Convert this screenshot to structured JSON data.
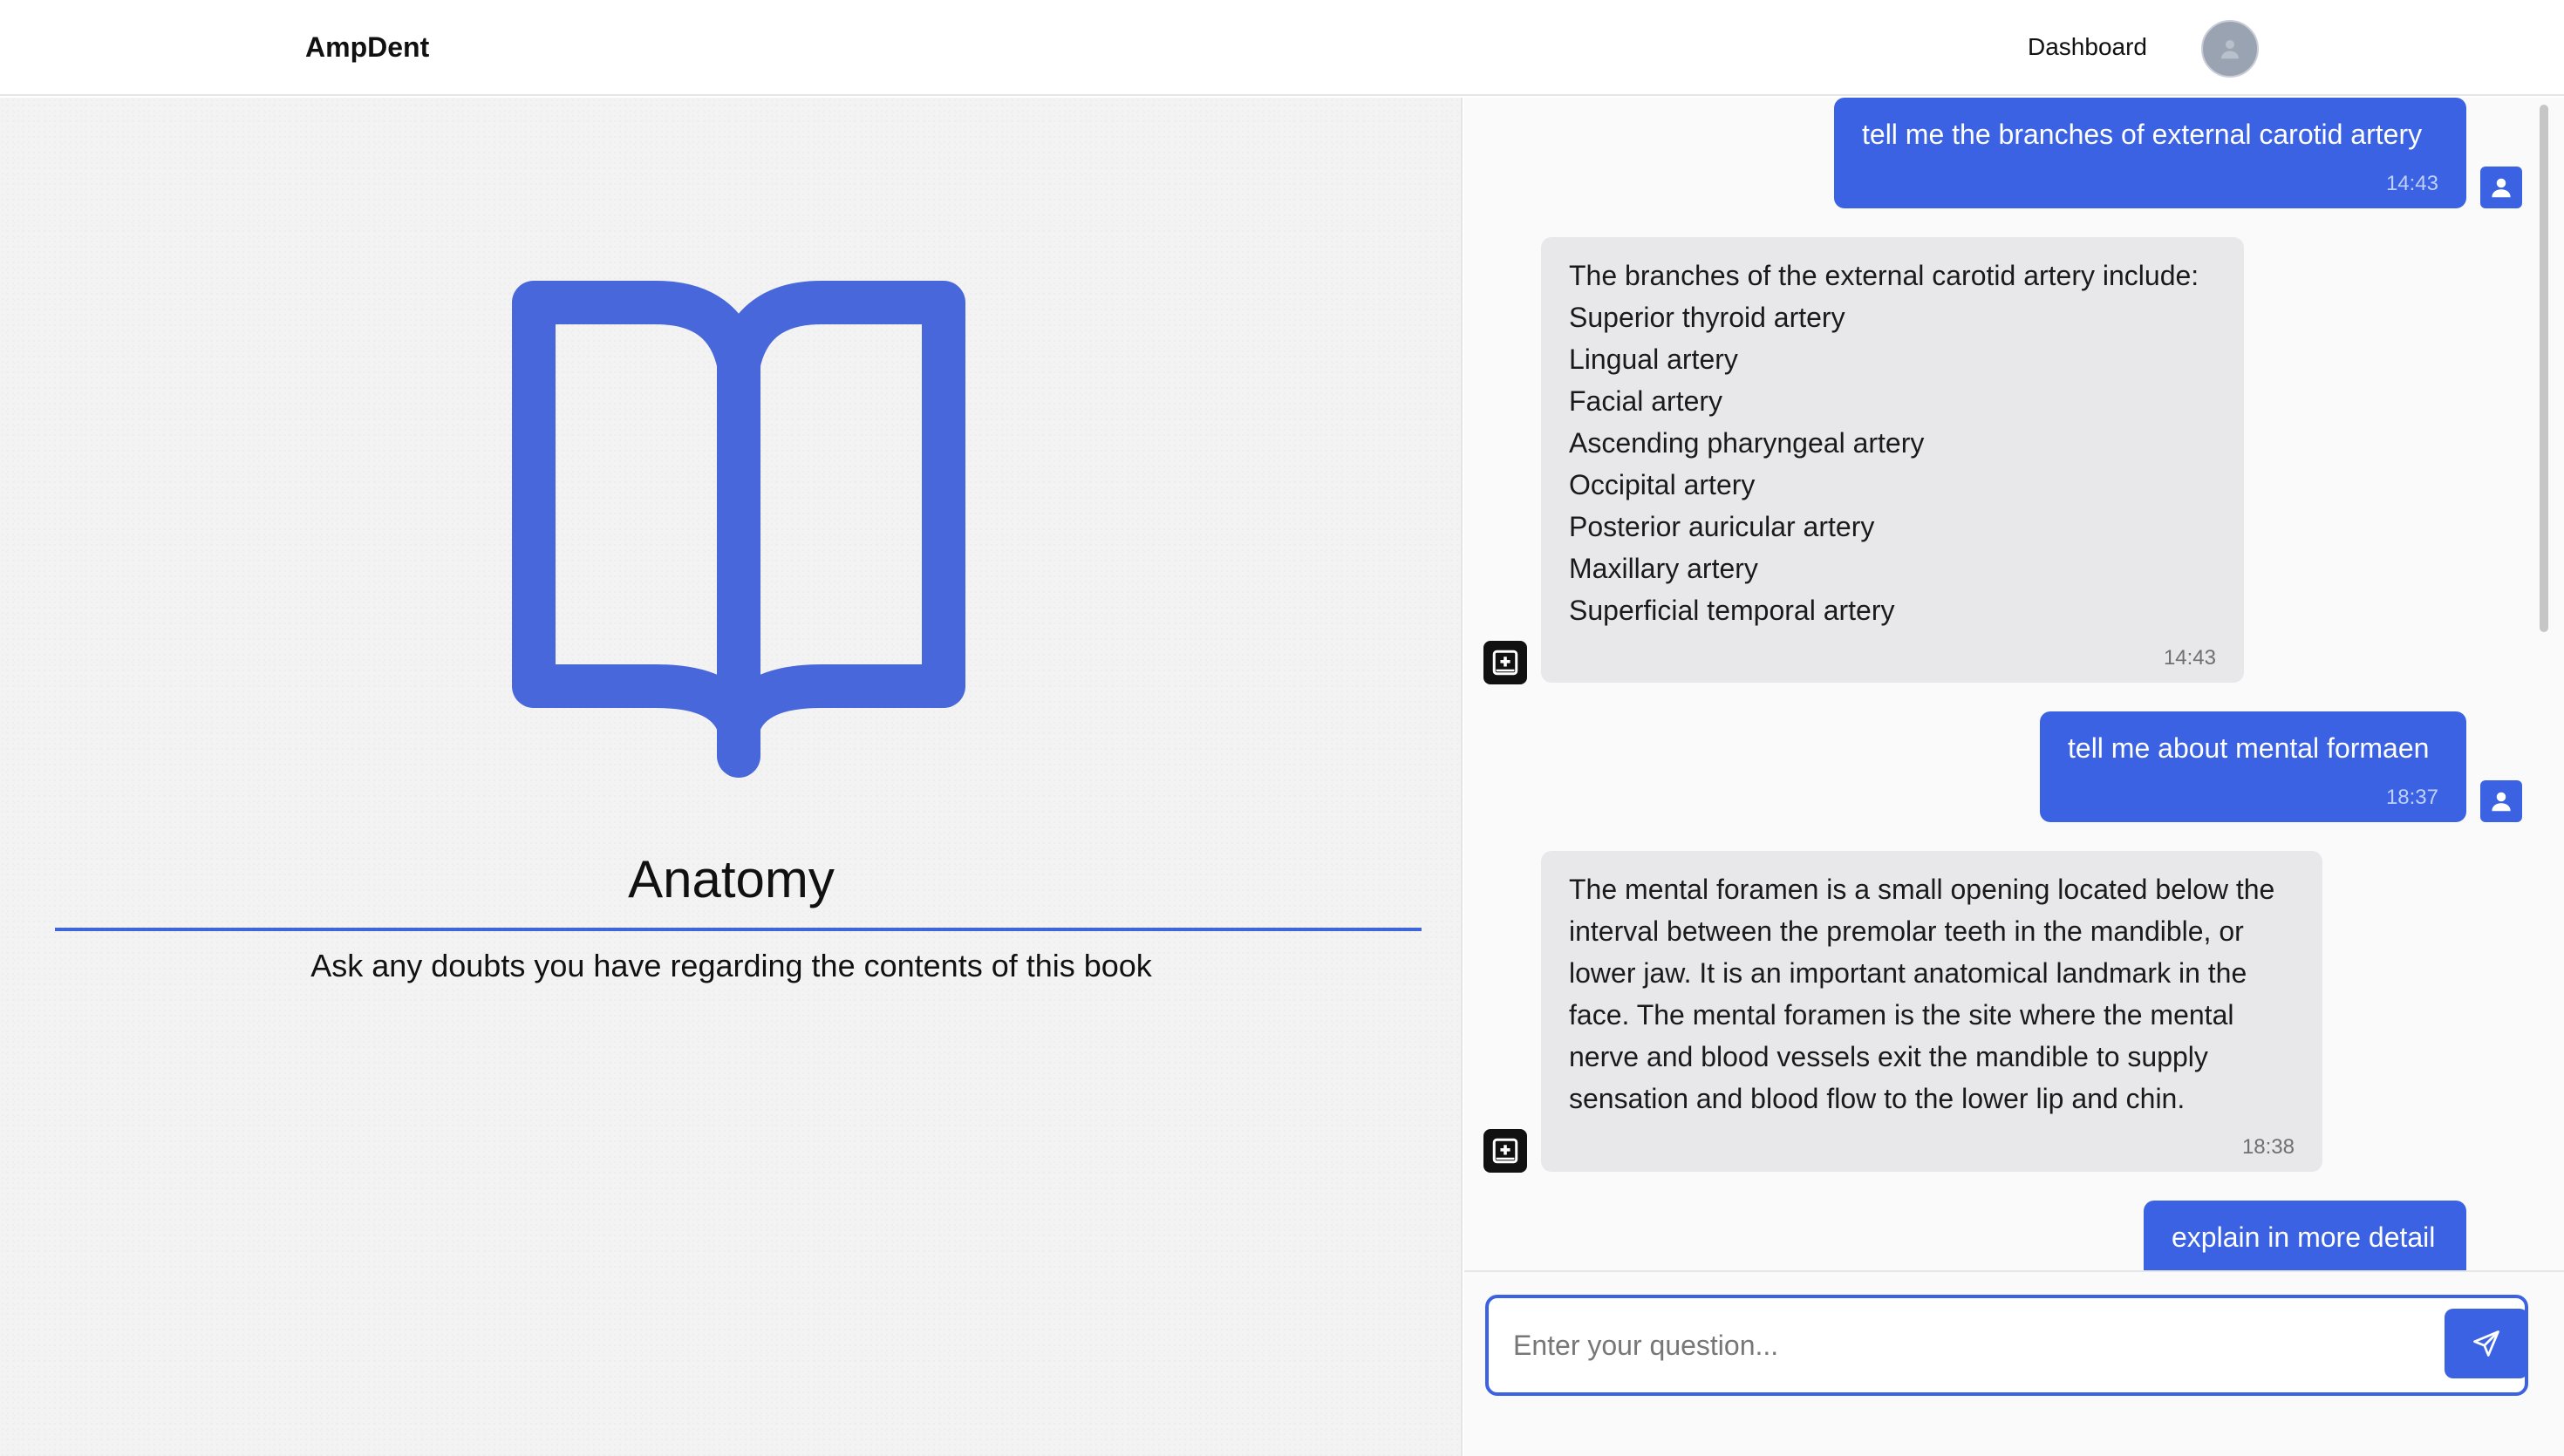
{
  "header": {
    "brand": "AmpDent",
    "nav_dashboard": "Dashboard",
    "avatar_icon": "user-avatar-icon"
  },
  "book": {
    "icon": "open-book-icon",
    "title": "Anatomy",
    "subtitle": "Ask any doubts you have regarding the contents of this book"
  },
  "chat": {
    "messages": [
      {
        "role": "user",
        "text": "tell me the branches of external carotid artery",
        "time": "14:43"
      },
      {
        "role": "assistant",
        "text": "The branches of the external carotid artery include:\nSuperior thyroid artery\nLingual artery\nFacial artery\nAscending pharyngeal artery\nOccipital artery\nPosterior auricular artery\nMaxillary artery\nSuperficial temporal artery",
        "time": "14:43"
      },
      {
        "role": "user",
        "text": "tell me about mental formaen",
        "time": "18:37"
      },
      {
        "role": "assistant",
        "text": "The mental foramen is a small opening located below the\ninterval between the premolar teeth in the mandible, or\nlower jaw. It is an important anatomical landmark in the\nface. The mental foramen is the site where the mental\nnerve and blood vessels exit the mandible to supply\nsensation and blood flow to the lower lip and chin.",
        "time": "18:38"
      },
      {
        "role": "user",
        "text": "explain in more detail",
        "time": ""
      }
    ]
  },
  "composer": {
    "placeholder": "Enter your question...",
    "value": "",
    "send_icon": "send-icon"
  },
  "colors": {
    "accent": "#3b62e2",
    "book_icon": "#4767db",
    "bot_bubble": "#e8e8ea",
    "left_bg": "#f3f3f3"
  }
}
